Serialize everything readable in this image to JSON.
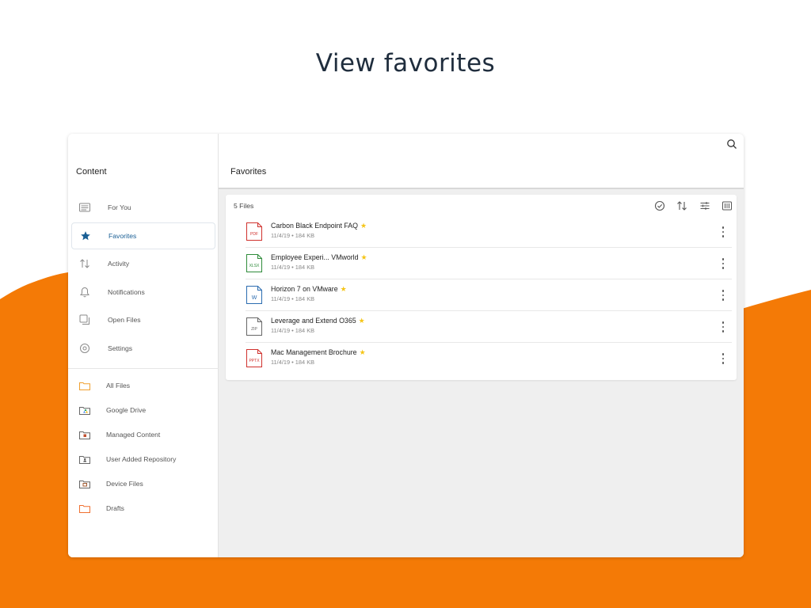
{
  "headline": "View favorites",
  "colors": {
    "accent": "#f47a06",
    "brand_blue": "#1a5f95",
    "star": "#f5c518"
  },
  "sidebar": {
    "title": "Content",
    "items": [
      {
        "label": "For You",
        "icon": "for-you-icon",
        "active": false
      },
      {
        "label": "Favorites",
        "icon": "star-icon",
        "active": true
      },
      {
        "label": "Activity",
        "icon": "activity-icon",
        "active": false
      },
      {
        "label": "Notifications",
        "icon": "bell-icon",
        "active": false
      },
      {
        "label": "Open Files",
        "icon": "open-files-icon",
        "active": false
      },
      {
        "label": "Settings",
        "icon": "settings-icon",
        "active": false
      }
    ],
    "repositories": [
      {
        "label": "All Files",
        "icon": "folder-icon"
      },
      {
        "label": "Google Drive",
        "icon": "google-drive-folder-icon"
      },
      {
        "label": "Managed Content",
        "icon": "managed-folder-icon"
      },
      {
        "label": "User Added Repository",
        "icon": "user-repo-folder-icon"
      },
      {
        "label": "Device Files",
        "icon": "device-folder-icon"
      },
      {
        "label": "Drafts",
        "icon": "drafts-folder-icon"
      }
    ]
  },
  "main": {
    "title": "Favorites",
    "file_count": "5 Files",
    "files": [
      {
        "name": "Carbon Black Endpoint FAQ",
        "meta": "11/4/19 • 184 KB",
        "type": "PDF",
        "color": "#d0312d"
      },
      {
        "name": "Employee Experi... VMworld",
        "meta": "11/4/19 • 184 KB",
        "type": "XLSX",
        "color": "#2e8b3a"
      },
      {
        "name": "Horizon 7 on VMware",
        "meta": "11/4/19 • 184 KB",
        "type": "W",
        "color": "#2b6cb0"
      },
      {
        "name": "Leverage and Extend O365",
        "meta": "11/4/19 • 184 KB",
        "type": "ZIP",
        "color": "#666666"
      },
      {
        "name": "Mac Management Brochure",
        "meta": "11/4/19 • 184 KB",
        "type": "PPTX",
        "color": "#d0312d"
      }
    ]
  }
}
